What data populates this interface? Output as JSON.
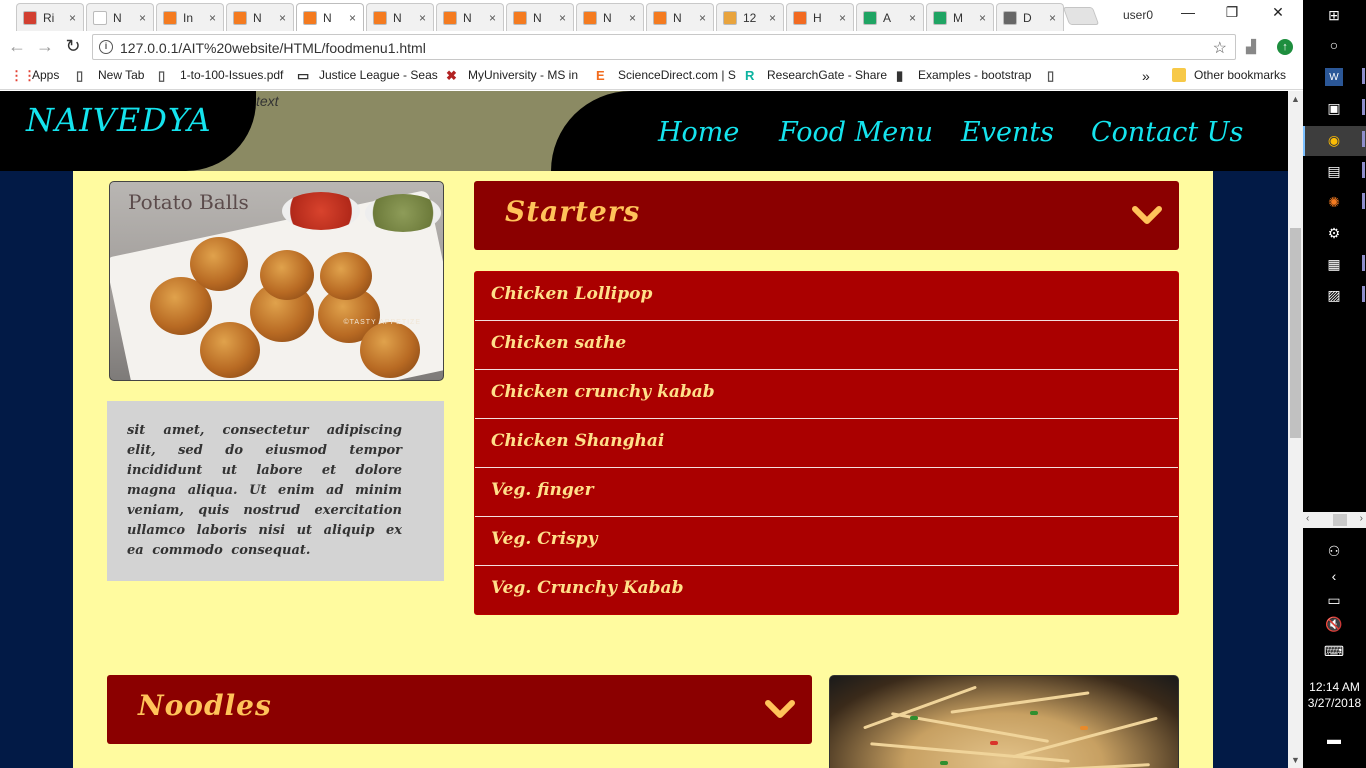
{
  "browser": {
    "tabs": [
      {
        "label": "Ri",
        "fav_color": "#d23f31"
      },
      {
        "label": "N",
        "fav_color": "#ffffff"
      },
      {
        "label": "In",
        "fav_color": "#f47b20"
      },
      {
        "label": "N",
        "fav_color": "#f47b20"
      },
      {
        "label": "N",
        "fav_color": "#f47b20",
        "active": true
      },
      {
        "label": "N",
        "fav_color": "#f47b20"
      },
      {
        "label": "N",
        "fav_color": "#f47b20"
      },
      {
        "label": "N",
        "fav_color": "#f47b20"
      },
      {
        "label": "N",
        "fav_color": "#f47b20"
      },
      {
        "label": "N",
        "fav_color": "#f47b20"
      },
      {
        "label": "12",
        "fav_color": "#e8a33c"
      },
      {
        "label": "H",
        "fav_color": "#f26a21"
      },
      {
        "label": "A",
        "fav_color": "#1fa463"
      },
      {
        "label": "M",
        "fav_color": "#1fa463"
      },
      {
        "label": "D",
        "fav_color": "#666666"
      }
    ],
    "close_glyph": "×",
    "user": "user0",
    "window_controls": {
      "minimize": "—",
      "restore": "❐",
      "close": "✕"
    },
    "url": "127.0.0.1/AIT%20website/HTML/foodmenu1.html",
    "bookmarks": [
      {
        "label": "Apps",
        "icon": "apps-grid-icon"
      },
      {
        "label": "New Tab",
        "icon": "page-icon"
      },
      {
        "label": "1-to-100-Issues.pdf",
        "icon": "page-icon"
      },
      {
        "label": "Justice League - Seas",
        "icon": "screen-icon"
      },
      {
        "label": "MyUniversity - MS in",
        "icon": "x-icon"
      },
      {
        "label": "ScienceDirect.com | S",
        "icon": "e-icon"
      },
      {
        "label": "ResearchGate - Share",
        "icon": "rg-icon"
      },
      {
        "label": "Examples - bootstrap",
        "icon": "book-icon"
      },
      {
        "label": "",
        "icon": "page-icon"
      }
    ],
    "other_bookmarks": "Other bookmarks",
    "more_glyph": "»"
  },
  "site": {
    "logo": "NAIVEDYA",
    "ghost_text": "text",
    "nav": [
      "Home",
      "Food Menu",
      "Events",
      "Contact Us"
    ],
    "image_caption": "Potato Balls",
    "image_watermark": "©TASTY APPETIZE",
    "description": "sit amet, consectetur adipiscing elit, sed do eiusmod tempor incididunt ut labore et dolore magna aliqua. Ut enim ad minim veniam, quis nostrud exercitation ullamco laboris nisi ut aliquip ex ea commodo consequat.",
    "sections": [
      {
        "title": "Starters",
        "items": [
          "Chicken Lollipop",
          "Chicken sathe",
          "Chicken crunchy kabab",
          "Chicken Shanghai",
          "Veg. finger",
          "Veg. Crispy",
          "Veg. Crunchy Kabab"
        ]
      },
      {
        "title": "Noodles",
        "items": []
      }
    ],
    "colors": {
      "accent_cyan": "#15e4ee",
      "section_header": "#8b0000",
      "menu_item_bg": "#aa0000",
      "section_title": "#ffc35a",
      "menu_text": "#ffe08a",
      "content_bg": "#fffb9f",
      "page_bg": "#021a46"
    }
  },
  "taskbar": {
    "time": "12:14 AM",
    "date": "3/27/2018"
  }
}
